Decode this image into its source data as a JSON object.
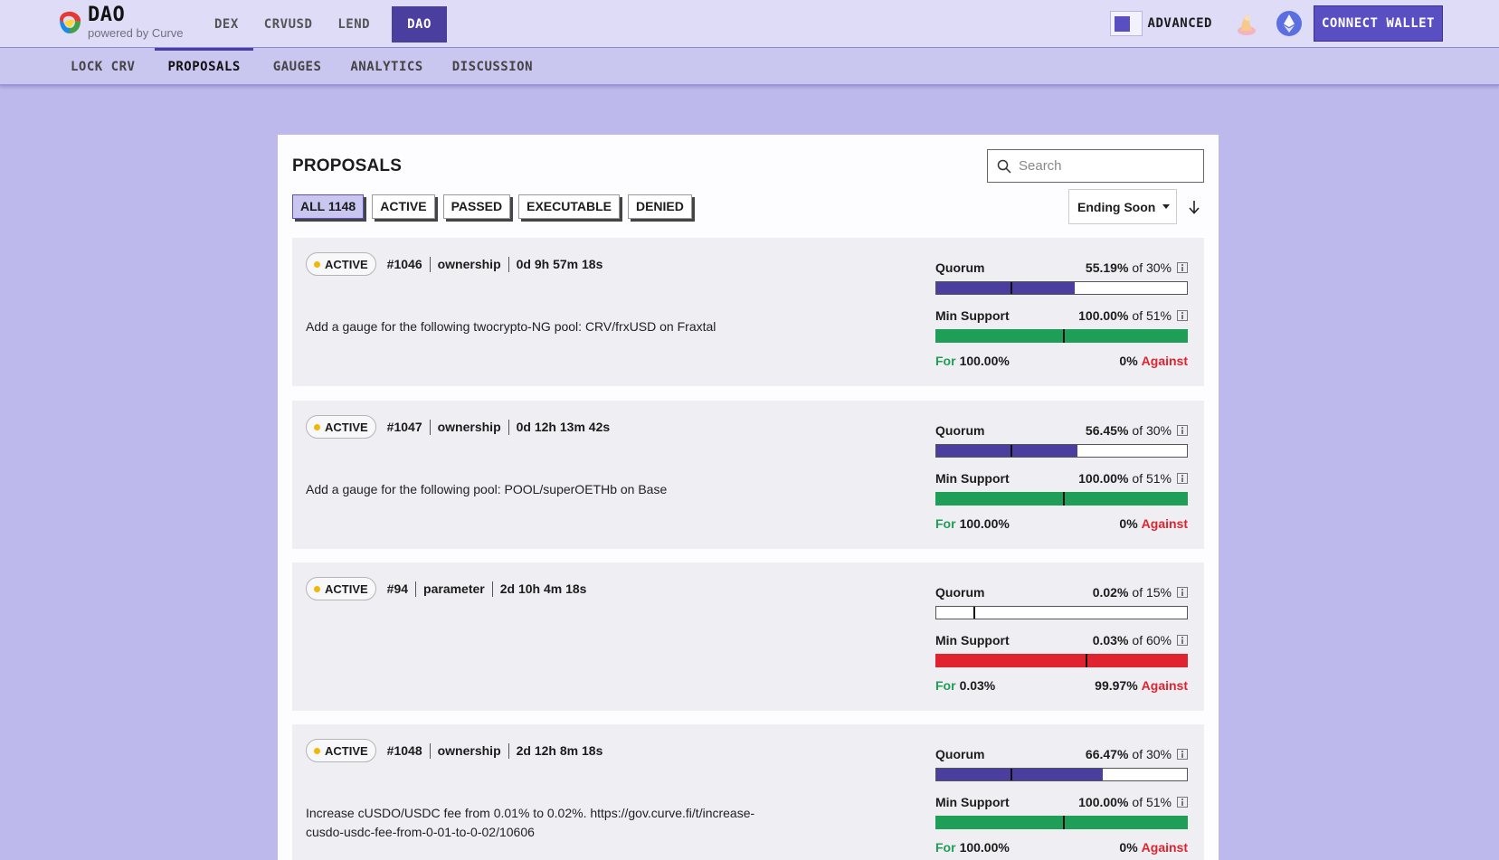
{
  "header": {
    "logo_title": "DAO",
    "logo_sub": "powered by Curve",
    "nav": [
      "DEX",
      "CRVUSD",
      "LEND",
      "DAO"
    ],
    "advanced_label": "ADVANCED",
    "connect_label": "CONNECT WALLET"
  },
  "subnav": [
    "LOCK CRV",
    "PROPOSALS",
    "GAUGES",
    "ANALYTICS",
    "DISCUSSION"
  ],
  "proposals": {
    "title": "PROPOSALS",
    "search_placeholder": "Search",
    "filters": [
      "ALL 1148",
      "ACTIVE",
      "PASSED",
      "EXECUTABLE",
      "DENIED"
    ],
    "sort_label": "Ending Soon",
    "quorum_label": "Quorum",
    "support_label": "Min Support",
    "for_label": "For",
    "against_label": "Against",
    "items": [
      {
        "status": "ACTIVE",
        "id": "#1046",
        "type": "ownership",
        "time": "0d 9h 57m 18s",
        "description": "Add a gauge for the following twocrypto-NG pool: CRV/frxUSD on Fraxtal",
        "quorum_pct": "55.19%",
        "quorum_of": "of 30%",
        "quorum_value": 55.19,
        "quorum_threshold": 30,
        "support_pct": "100.00%",
        "support_of": "of 51%",
        "support_value": 100.0,
        "support_threshold": 51,
        "support_color": "green",
        "for_pct": "100.00%",
        "against_pct": "0%"
      },
      {
        "status": "ACTIVE",
        "id": "#1047",
        "type": "ownership",
        "time": "0d 12h 13m 42s",
        "description": "Add a gauge for the following pool: POOL/superOETHb on Base",
        "quorum_pct": "56.45%",
        "quorum_of": "of 30%",
        "quorum_value": 56.45,
        "quorum_threshold": 30,
        "support_pct": "100.00%",
        "support_of": "of 51%",
        "support_value": 100.0,
        "support_threshold": 51,
        "support_color": "green",
        "for_pct": "100.00%",
        "against_pct": "0%"
      },
      {
        "status": "ACTIVE",
        "id": "#94",
        "type": "parameter",
        "time": "2d 10h 4m 18s",
        "description": "",
        "quorum_pct": "0.02%",
        "quorum_of": "of 15%",
        "quorum_value": 0.02,
        "quorum_threshold": 15,
        "support_pct": "0.03%",
        "support_of": "of 60%",
        "support_value": 0.03,
        "support_threshold": 60,
        "support_color": "red",
        "for_pct": "0.03%",
        "against_pct": "99.97%"
      },
      {
        "status": "ACTIVE",
        "id": "#1048",
        "type": "ownership",
        "time": "2d 12h 8m 18s",
        "description": "Increase cUSDO/USDC fee from 0.01% to 0.02%. https://gov.curve.fi/t/increase-cusdo-usdc-fee-from-0-01-to-0-02/10606",
        "quorum_pct": "66.47%",
        "quorum_of": "of 30%",
        "quorum_value": 66.47,
        "quorum_threshold": 30,
        "support_pct": "100.00%",
        "support_of": "of 51%",
        "support_value": 100.0,
        "support_threshold": 51,
        "support_color": "green",
        "for_pct": "100.00%",
        "against_pct": "0%"
      }
    ]
  },
  "colors": {
    "accent": "#4a3f9f",
    "for": "#1e9e56",
    "against": "#e0242f",
    "background": "#bdb9ec"
  },
  "icons": [
    "curve-logo-icon",
    "theme-icon",
    "ethereum-icon",
    "search-icon",
    "sort-direction-icon",
    "info-icon"
  ]
}
